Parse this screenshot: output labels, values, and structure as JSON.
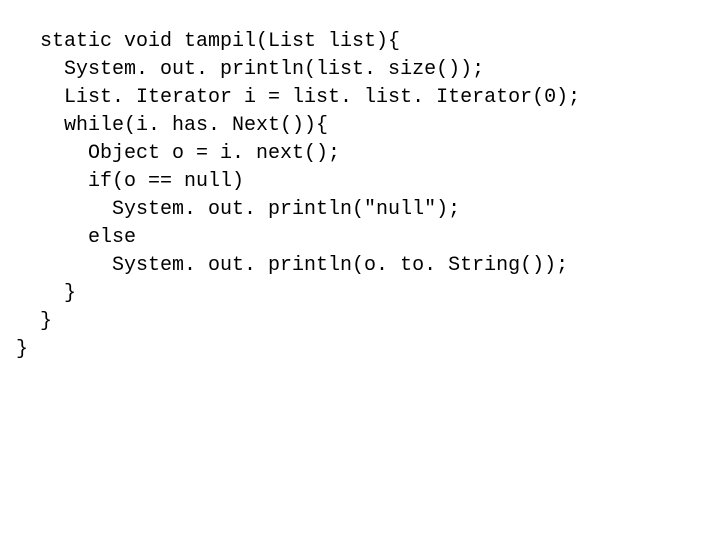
{
  "code": {
    "lines": [
      "  static void tampil(List list){",
      "    System. out. println(list. size());",
      "    List. Iterator i = list. list. Iterator(0);",
      "    while(i. has. Next()){",
      "      Object o = i. next();",
      "      if(o == null)",
      "        System. out. println(\"null\");",
      "      else",
      "        System. out. println(o. to. String());",
      "    }",
      "  }",
      "}"
    ]
  }
}
